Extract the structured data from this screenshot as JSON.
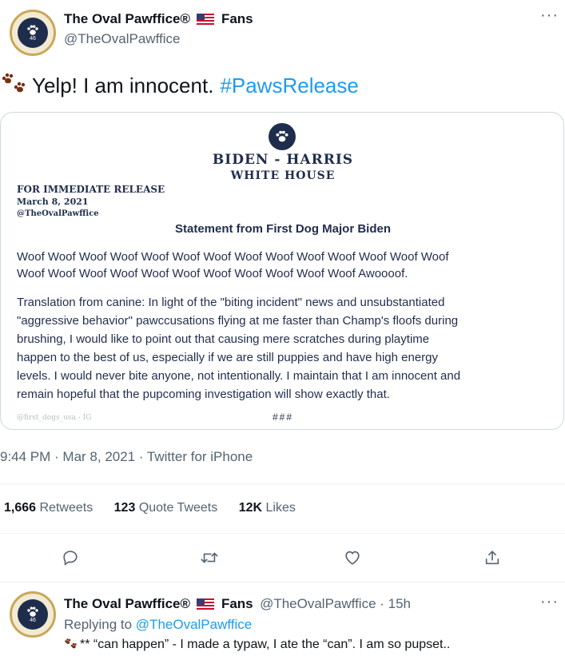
{
  "tweet": {
    "author_name": "The Oval Pawffice®",
    "author_suffix": "Fans",
    "handle": "@TheOvalPawffice",
    "avatar_badge": "46",
    "text": "Yelp! I am innocent.",
    "hashtag": "#PawsRelease",
    "more": "···",
    "timestamp": "9:44 PM · Mar 8, 2021 · Twitter for iPhone"
  },
  "press_release": {
    "header_line1": "BIDEN - HARRIS",
    "header_line2": "WHITE HOUSE",
    "for_release": "FOR IMMEDIATE RELEASE",
    "date": "March 8, 2021",
    "source": "@TheOvalPawffice",
    "title": "Statement from First Dog Major Biden",
    "woof_line1": "Woof Woof Woof Woof Woof Woof Woof Woof Woof Woof Woof Woof Woof Woof",
    "woof_line2": "Woof Woof Woof Woof Woof Woof Woof Woof Woof Woof Woof Awoooof.",
    "translation": [
      "Translation from canine: In light of the \"biting incident\" news and unsubstantiated",
      "\"aggressive behavior\" pawccusations flying at me faster than Champ's floofs during",
      "brushing, I would like to point out that causing mere scratches during playtime",
      "happen to the best of us, especially if we are still puppies and have high energy",
      "levels. I would never bite anyone, not intentionally. I maintain that I am innocent and",
      "remain hopeful that the pupcoming investigation will show exactly that."
    ],
    "watermark": "@first_dogs_usa - IG",
    "end_marks": "###"
  },
  "stats": {
    "retweets_count": "1,666",
    "retweets_label": "Retweets",
    "quotes_count": "123",
    "quotes_label": "Quote Tweets",
    "likes_count": "12K",
    "likes_label": "Likes"
  },
  "actions": [
    "reply-icon",
    "retweet-icon",
    "like-icon",
    "share-icon"
  ],
  "reply": {
    "author_name": "The Oval Pawffice®",
    "author_suffix": "Fans",
    "handle_time": "@TheOvalPawffice · 15h",
    "replying_prefix": "Replying to",
    "replying_handle": "@TheOvalPawffice",
    "text": "** “can happen” - I made a typaw, I ate the “can”. I am so pupset..",
    "more": "···"
  },
  "colors": {
    "link": "#1d9bf0",
    "muted": "#536471",
    "border": "#cfd9de",
    "navy": "#1f2d4d",
    "paw": "#7a2e12"
  }
}
